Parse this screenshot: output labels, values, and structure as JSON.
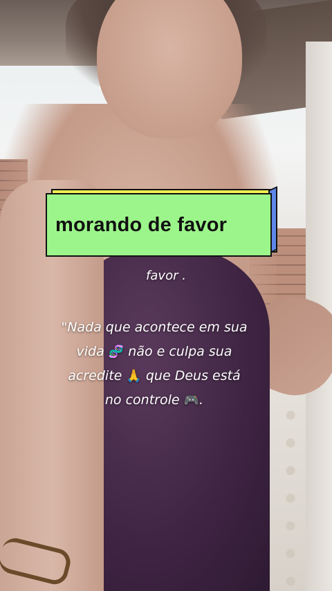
{
  "overlay": {
    "title": "morando de favor",
    "caption": "favor .",
    "quote_line1": "\"Nada que acontece em sua",
    "quote_line2a": "vida",
    "quote_emoji1": "🧬",
    "quote_line2b": "não e culpa sua",
    "quote_line3a": "acredite",
    "quote_emoji2": "🙏",
    "quote_line3b": "que Deus está",
    "quote_line4a": "no controle",
    "quote_emoji3": "🎮",
    "quote_line4b": "."
  },
  "colors": {
    "banner_face": "#9cf58a",
    "banner_shadow": "#f0ee4f",
    "banner_side": "#5f86e8",
    "text": "#ffffff"
  }
}
